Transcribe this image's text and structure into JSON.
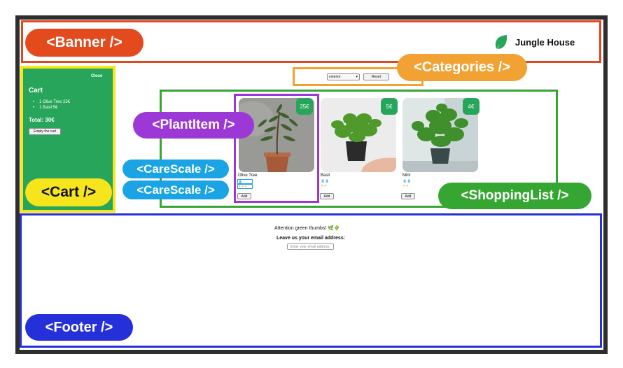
{
  "labels": {
    "banner": "<Banner />",
    "categories": "<Categories />",
    "plant_item": "<PlantItem />",
    "care_scale_1": "<CareScale />",
    "care_scale_2": "<CareScale />",
    "cart": "<Cart />",
    "shopping_list": "<ShoppingList />",
    "footer": "<Footer />"
  },
  "banner": {
    "title": "Jungle House",
    "icon": "leaf-icon"
  },
  "cart": {
    "close_label": "Close",
    "title": "Cart",
    "items": [
      "1 Olive Tree 25€",
      "1 Basil 5€"
    ],
    "total": "Total: 30€",
    "empty_label": "Empty the cart"
  },
  "categories": {
    "selected": "exterior",
    "reset_label": "Reset"
  },
  "plants": [
    {
      "name": "Olive Tree",
      "price": "25€",
      "water": "💧",
      "light": "☀☀☀",
      "add_label": "Add"
    },
    {
      "name": "Basil",
      "price": "5€",
      "water": "💧💧",
      "light": "☀☀",
      "add_label": "Add"
    },
    {
      "name": "Mint",
      "price": "4€",
      "water": "💧💧",
      "light": "☀☀",
      "add_label": "Add"
    }
  ],
  "footer": {
    "attention": "Attention green thumbs! 🌿🌵",
    "leave": "Leave us your email address:",
    "email_placeholder": "Enter your email address"
  },
  "colors": {
    "banner": "#e0481f",
    "categories": "#f2a232",
    "plant_item": "#9b38d6",
    "care_scale": "#1aa4e6",
    "cart": "#f6e41d",
    "shopping_list": "#36a632",
    "footer": "#2630d8",
    "brand_green": "#27a55a"
  }
}
